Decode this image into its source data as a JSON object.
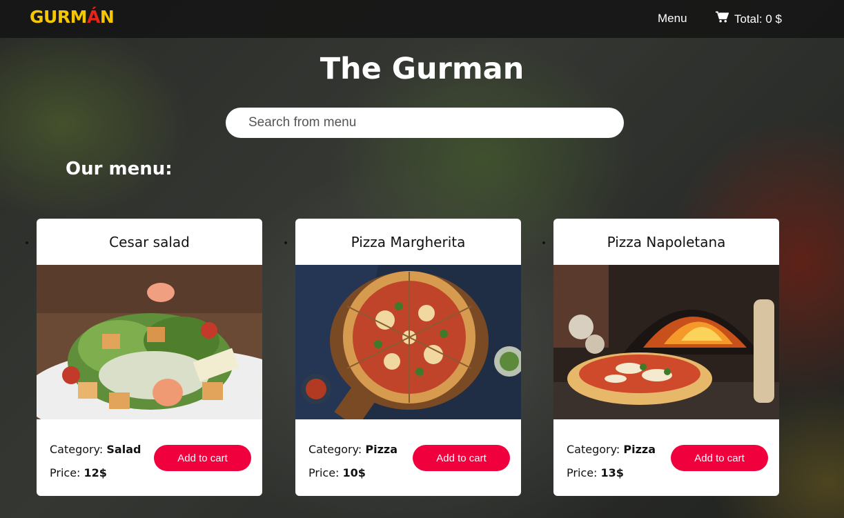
{
  "header": {
    "logo_main": "GURM",
    "logo_accent": "Á",
    "logo_end": "N",
    "menu_label": "Menu",
    "cart_label": "Total: 0 $",
    "cart_icon": "shopping-cart-icon"
  },
  "hero": {
    "title": "The Gurman",
    "search_placeholder": "Search from menu",
    "section_title": "Our menu:"
  },
  "labels": {
    "category": "Category:",
    "price": "Price:",
    "add_to_cart": "Add to cart"
  },
  "items": [
    {
      "name": "Cesar salad",
      "category": "Salad",
      "price": "12$"
    },
    {
      "name": "Pizza Margherita",
      "category": "Pizza",
      "price": "10$"
    },
    {
      "name": "Pizza Napoletana",
      "category": "Pizza",
      "price": "13$"
    }
  ],
  "colors": {
    "accent": "#f0003c",
    "logo": "#f6c700",
    "header_bg": "#141414"
  }
}
